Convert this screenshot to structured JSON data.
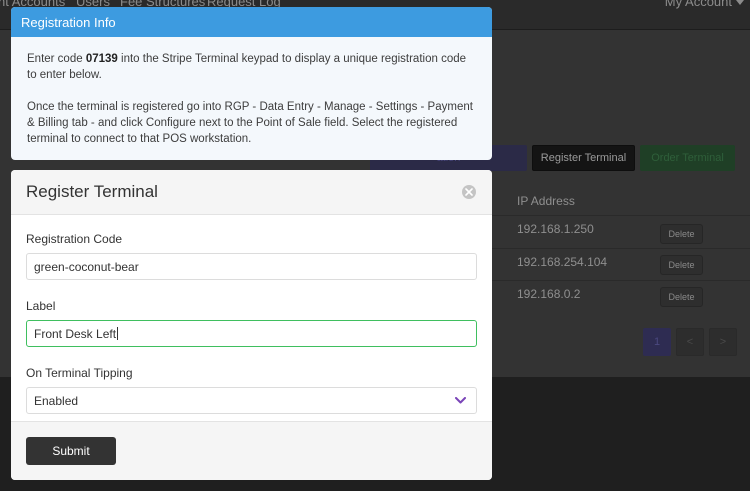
{
  "nav": {
    "links": [
      "nt Accounts",
      "Users",
      "Fee Structures",
      "Request Log"
    ],
    "account_label": "My Account"
  },
  "background": {
    "purple_button_label": "ation",
    "register_terminal_label": "Register Terminal",
    "order_terminal_label": "Order Terminal",
    "ip_header": "IP Address",
    "rows": [
      {
        "ip": "192.168.1.250",
        "action": "Delete"
      },
      {
        "ip": "192.168.254.104",
        "action": "Delete"
      },
      {
        "ip": "192.168.0.2",
        "action": "Delete"
      }
    ],
    "pagination": {
      "current": "1",
      "prev": "<",
      "next": ">"
    }
  },
  "info": {
    "title": "Registration Info",
    "p1_pre": "Enter code ",
    "code": "07139",
    "p1_post": " into the Stripe Terminal keypad to display a unique registration code to enter below.",
    "p2": "Once the terminal is registered go into RGP - Data Entry - Manage - Settings - Payment & Billing tab - and click Configure next to the Point of Sale field. Select the registered terminal to connect to that POS workstation."
  },
  "modal": {
    "title": "Register Terminal",
    "registration_code_label": "Registration Code",
    "registration_code_value": "green-coconut-bear",
    "label_label": "Label",
    "label_value": "Front Desk Left",
    "tipping_label": "On Terminal Tipping",
    "tipping_value": "Enabled",
    "submit_label": "Submit"
  },
  "colors": {
    "info_header": "#3d9be0",
    "focus_border": "#3fbf5f",
    "chevron": "#7a45b8",
    "submit": "#333333"
  }
}
